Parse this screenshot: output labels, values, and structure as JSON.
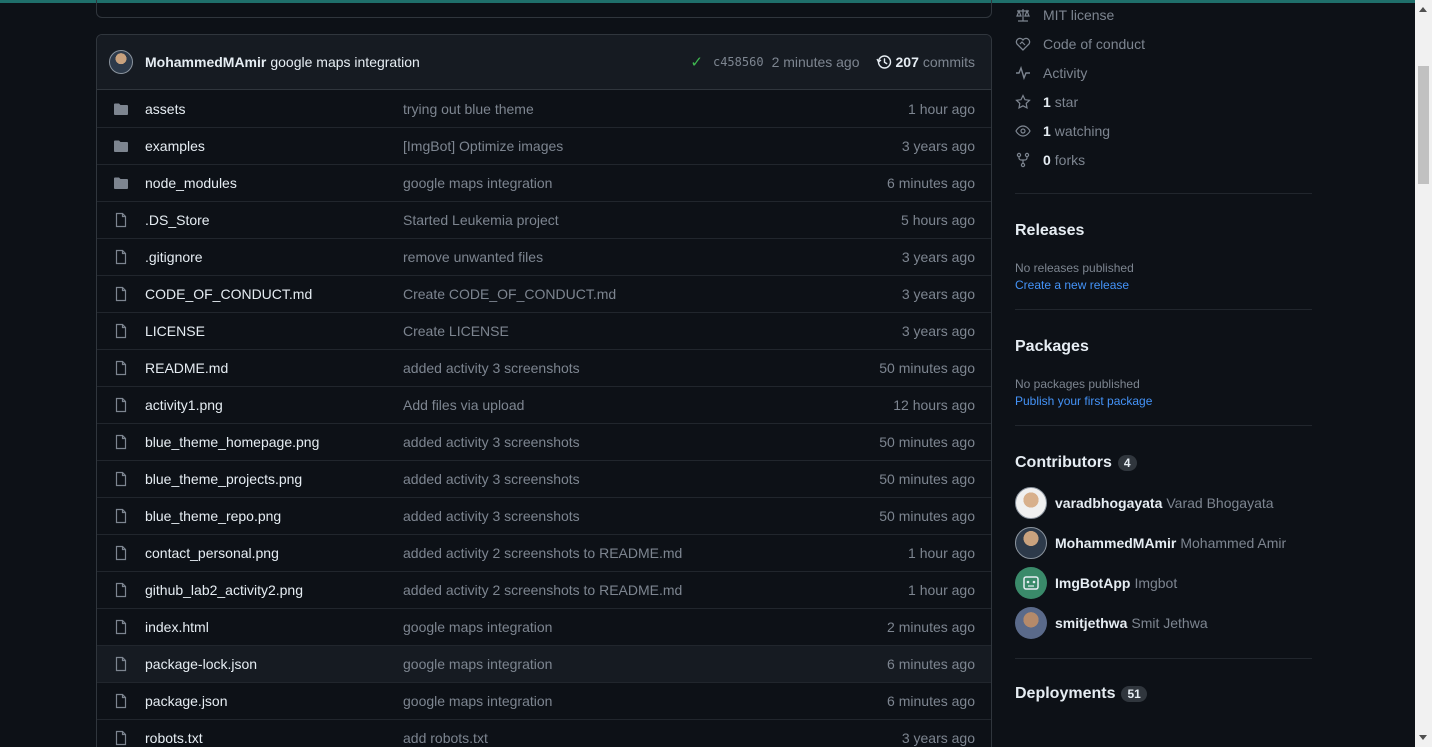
{
  "commit": {
    "author": "MohammedMAmir",
    "message": "google maps integration",
    "sha": "c458560",
    "time": "2 minutes ago",
    "commits_count": "207",
    "commits_label": "commits"
  },
  "files": [
    {
      "name": "assets",
      "type": "folder",
      "message": "trying out blue theme",
      "time": "1 hour ago"
    },
    {
      "name": "examples",
      "type": "folder",
      "message": "[ImgBot] Optimize images",
      "time": "3 years ago"
    },
    {
      "name": "node_modules",
      "type": "folder",
      "message": "google maps integration",
      "time": "6 minutes ago"
    },
    {
      "name": ".DS_Store",
      "type": "file",
      "message": "Started Leukemia project",
      "time": "5 hours ago"
    },
    {
      "name": ".gitignore",
      "type": "file",
      "message": "remove unwanted files",
      "time": "3 years ago"
    },
    {
      "name": "CODE_OF_CONDUCT.md",
      "type": "file",
      "message": "Create CODE_OF_CONDUCT.md",
      "time": "3 years ago"
    },
    {
      "name": "LICENSE",
      "type": "file",
      "message": "Create LICENSE",
      "time": "3 years ago"
    },
    {
      "name": "README.md",
      "type": "file",
      "message": "added activity 3 screenshots",
      "time": "50 minutes ago"
    },
    {
      "name": "activity1.png",
      "type": "file",
      "message": "Add files via upload",
      "time": "12 hours ago"
    },
    {
      "name": "blue_theme_homepage.png",
      "type": "file",
      "message": "added activity 3 screenshots",
      "time": "50 minutes ago"
    },
    {
      "name": "blue_theme_projects.png",
      "type": "file",
      "message": "added activity 3 screenshots",
      "time": "50 minutes ago"
    },
    {
      "name": "blue_theme_repo.png",
      "type": "file",
      "message": "added activity 3 screenshots",
      "time": "50 minutes ago"
    },
    {
      "name": "contact_personal.png",
      "type": "file",
      "message": "added activity 2 screenshots to README.md",
      "time": "1 hour ago"
    },
    {
      "name": "github_lab2_activity2.png",
      "type": "file",
      "message": "added activity 2 screenshots to README.md",
      "time": "1 hour ago"
    },
    {
      "name": "index.html",
      "type": "file",
      "message": "google maps integration",
      "time": "2 minutes ago"
    },
    {
      "name": "package-lock.json",
      "type": "file",
      "message": "google maps integration",
      "time": "6 minutes ago"
    },
    {
      "name": "package.json",
      "type": "file",
      "message": "google maps integration",
      "time": "6 minutes ago"
    },
    {
      "name": "robots.txt",
      "type": "file",
      "message": "add robots.txt",
      "time": "3 years ago"
    }
  ],
  "about": {
    "license": "MIT license",
    "code_of_conduct": "Code of conduct",
    "activity": "Activity",
    "stars_count": "1",
    "stars_label": "star",
    "watching_count": "1",
    "watching_label": "watching",
    "forks_count": "0",
    "forks_label": "forks"
  },
  "releases": {
    "heading": "Releases",
    "empty_text": "No releases published",
    "link": "Create a new release"
  },
  "packages": {
    "heading": "Packages",
    "empty_text": "No packages published",
    "link": "Publish your first package"
  },
  "contributors": {
    "heading": "Contributors",
    "count": "4",
    "list": [
      {
        "login": "varadbhogayata",
        "name": "Varad Bhogayata"
      },
      {
        "login": "MohammedMAmir",
        "name": "Mohammed Amir"
      },
      {
        "login": "ImgBotApp",
        "name": "Imgbot"
      },
      {
        "login": "smitjethwa",
        "name": "Smit Jethwa"
      }
    ]
  },
  "deployments": {
    "heading": "Deployments",
    "count": "51"
  }
}
